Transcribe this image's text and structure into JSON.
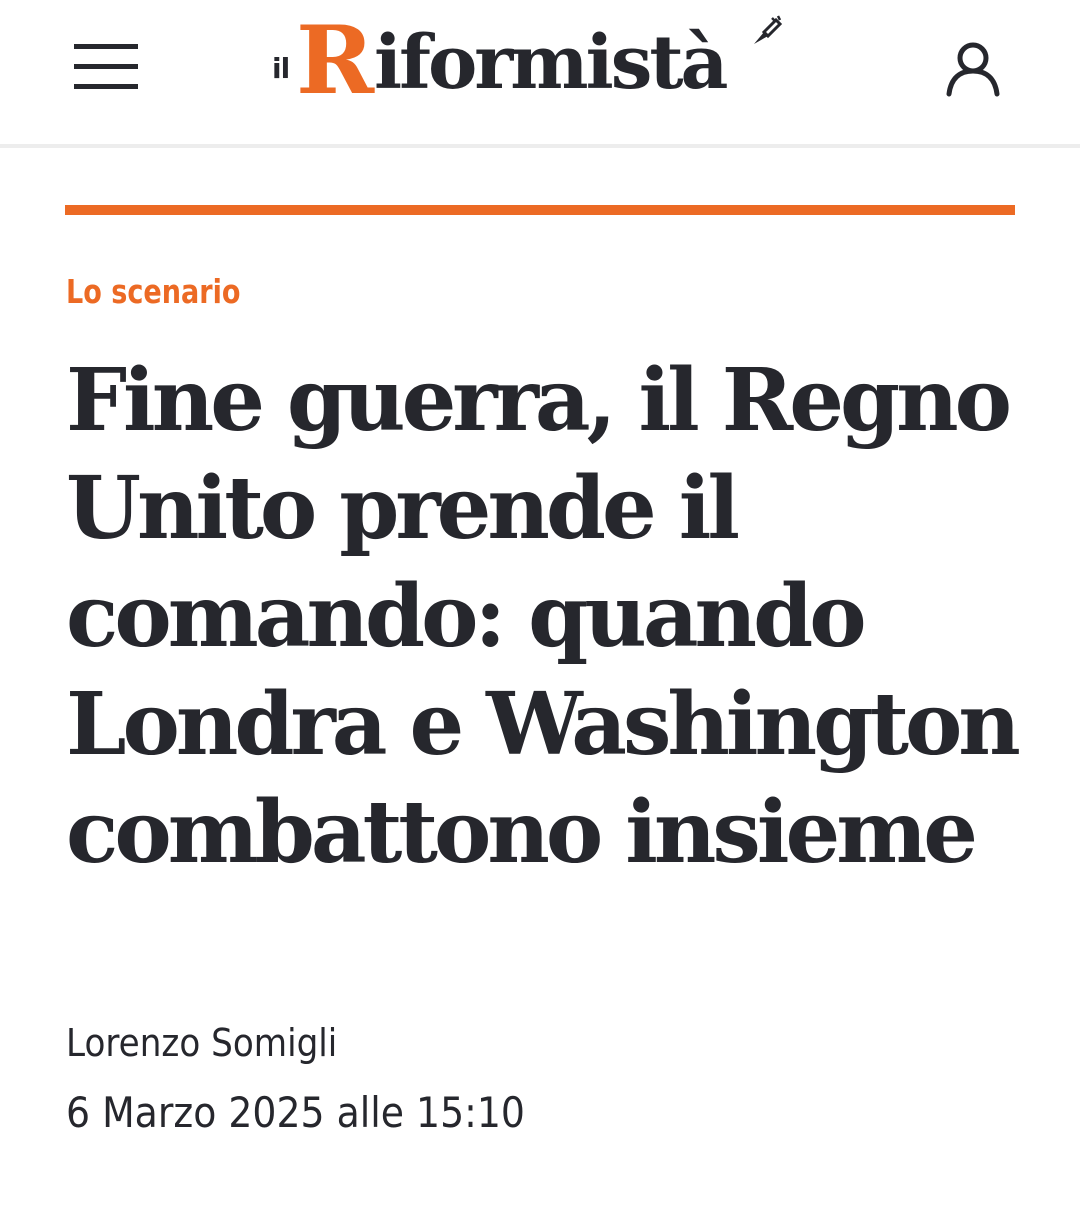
{
  "header": {
    "logo": {
      "prefix": "il",
      "initial": "R",
      "rest": "iformistà"
    },
    "icons": {
      "menu": "hamburger-menu-icon",
      "user": "user-account-icon",
      "logo_mark": "pen-accent-icon"
    }
  },
  "article": {
    "kicker": "Lo scenario",
    "headline": "Fine guerra, il Regno Unito prende il comando: quando Londra e Washington combattono insieme",
    "author": "Lorenzo Somigli",
    "date": "6 Marzo 2025 alle 15:10"
  },
  "colors": {
    "accent": "#ec6a24",
    "text": "#26272d",
    "background": "#ffffff",
    "header_divider": "#ededed"
  }
}
